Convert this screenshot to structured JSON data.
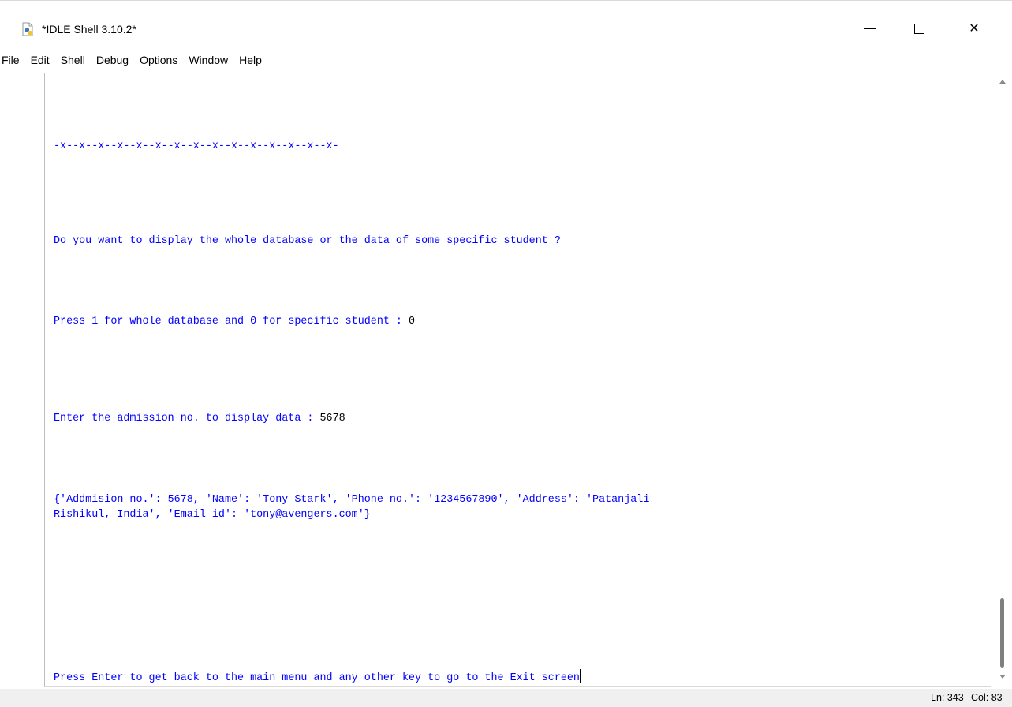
{
  "window": {
    "title": "*IDLE Shell 3.10.2*",
    "icon": "python-idle-icon",
    "controls": [
      "minimize-icon",
      "maximize-icon",
      "close-icon"
    ],
    "close_glyph": "✕"
  },
  "menu": {
    "items": [
      "File",
      "Edit",
      "Shell",
      "Debug",
      "Options",
      "Window",
      "Help"
    ]
  },
  "shell": {
    "separator": "-x--x--x--x--x--x--x--x--x--x--x--x--x--x--x-",
    "question": "Do you want to display the whole database or the data of some specific student ?",
    "press_prompt": "Press 1 for whole database and 0 for specific student : ",
    "press_input": "0",
    "admission_prompt": "Enter the admission no. to display data : ",
    "admission_input": "5678",
    "record_line1": "{'Addmision no.': 5678, 'Name': 'Tony Stark', 'Phone no.': '1234567890', 'Address': 'Patanjali",
    "record_line2": "Rishikul, India', 'Email id': 'tony@avengers.com'}",
    "final_prompt": "Press Enter to get back to the main menu and any other key to go to the Exit screen",
    "text_color": "#0000ff",
    "input_color": "#000000"
  },
  "status": {
    "ln": "Ln: 343",
    "col": "Col: 83"
  }
}
